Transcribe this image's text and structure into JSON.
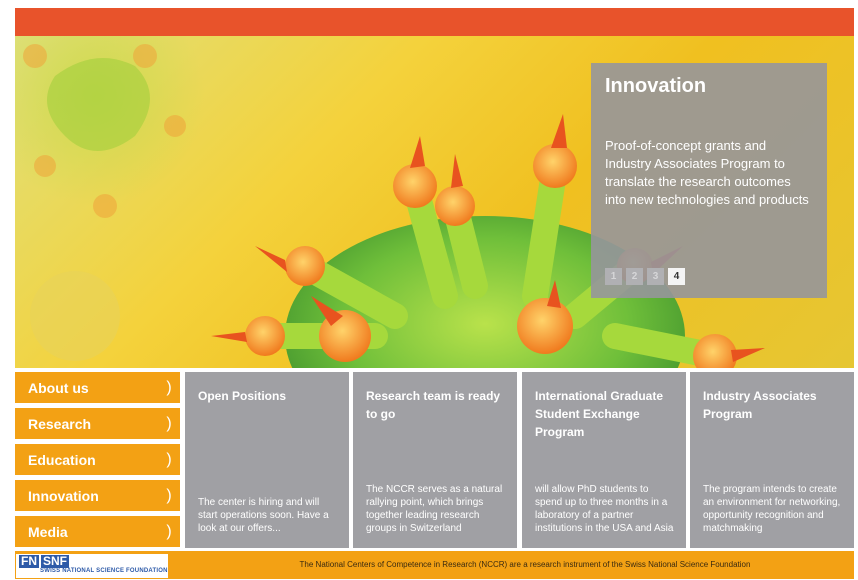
{
  "hero": {
    "title": "Innovation",
    "text": "Proof-of-concept grants and Industry Associates Program to translate the research outcomes into new technologies and products",
    "pages": [
      "1",
      "2",
      "3",
      "4"
    ],
    "active_page": "4"
  },
  "nav": {
    "items": [
      {
        "label": "About us",
        "chevron": ")"
      },
      {
        "label": "Research",
        "chevron": ")"
      },
      {
        "label": "Education",
        "chevron": ")"
      },
      {
        "label": "Innovation",
        "chevron": ")"
      },
      {
        "label": "Media",
        "chevron": ")"
      }
    ]
  },
  "tiles": [
    {
      "title": "Open Positions",
      "text": "The center is hiring and will start operations soon. Have a look at our offers..."
    },
    {
      "title": "Research team is ready to go",
      "text": "The NCCR serves as a natural rallying point, which brings together leading research groups in Switzerland"
    },
    {
      "title": "International Graduate Student Exchange Program",
      "text": "will allow PhD students to spend up to three months in a laboratory of a partner institutions in the USA and Asia"
    },
    {
      "title": "Industry Associates Program",
      "text": "The program intends to create an environment for networking, opportunity recognition and matchmaking"
    }
  ],
  "footer": {
    "logo_text": "FNSNF",
    "logo_fn": "FN",
    "logo_snf": "SNF",
    "logo_subtitle": "SWISS NATIONAL SCIENCE FOUNDATION",
    "text": "The National Centers of Competence in Research (NCCR) are a research instrument of the Swiss National Science Foundation"
  },
  "colors": {
    "topbar": "#e8532b",
    "nav": "#f3a114",
    "tile": "#a0a0a4",
    "footer": "#f3a114",
    "slidebox": "#96969b"
  }
}
